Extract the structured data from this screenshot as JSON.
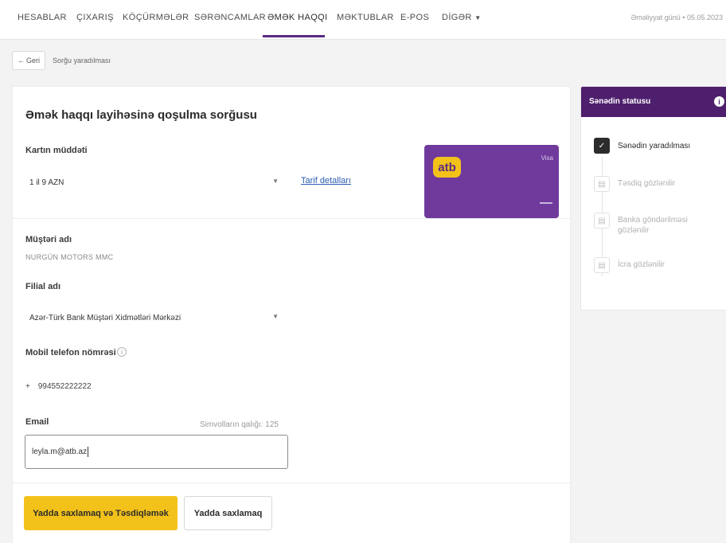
{
  "nav": {
    "items": [
      "HESABLAR",
      "ÇIXARIŞ",
      "KÖÇÜRMƏLƏR",
      "SƏRƏNCAMLAR",
      "ƏMƏK HAQQI",
      "MƏKTUBLAR",
      "E-POS",
      "DİGƏR"
    ],
    "operation_date": "Əməliyyat günü • 05.05.2023"
  },
  "breadcrumb": {
    "back_label": "Geri",
    "current": "Sorğu yaradılması"
  },
  "form": {
    "title": "Əmək haqqı layihəsinə qoşulma sorğusu",
    "card_term_label": "Kartın müddəti",
    "card_term_value": "1 il 9 AZN",
    "tariff_link": "Tarif detalları",
    "customer_label": "Müştəri adı",
    "customer_value": "NURGÜN MOTORS MMC",
    "branch_label": "Filial adı",
    "branch_value": "Azər-Türk Bank Müştəri Xidmətləri Mərkəzi",
    "phone_label": "Mobil telefon nömrəsi",
    "phone_prefix": "+",
    "phone_value": "994552222222",
    "email_label": "Email",
    "email_counter": "Simvolların qalığı: 125",
    "email_value": "leyla.m@atb.az",
    "primary_button": "Yadda saxlamaq və Təsdiqləmək",
    "secondary_button": "Yadda saxlamaq"
  },
  "bank_card": {
    "logo_text": "atb",
    "type_label": "Visa",
    "color": "#6f3a9c",
    "logo_color": "#f2c21b"
  },
  "status_panel": {
    "title": "Sənədin statusu",
    "steps": [
      {
        "label": "Sənədin yaradılması",
        "state": "done",
        "icon": "check-icon"
      },
      {
        "label": "Təsdiq gözlənilir",
        "state": "pending",
        "icon": "document-icon"
      },
      {
        "label": "Banka göndərilməsi gözlənilir",
        "state": "pending",
        "icon": "document-icon"
      },
      {
        "label": "İcra gözlənilir",
        "state": "pending",
        "icon": "document-icon"
      }
    ]
  },
  "colors": {
    "accent_purple": "#4e1f6d",
    "primary_yellow": "#f2c21b",
    "link_blue": "#2a5db0"
  }
}
